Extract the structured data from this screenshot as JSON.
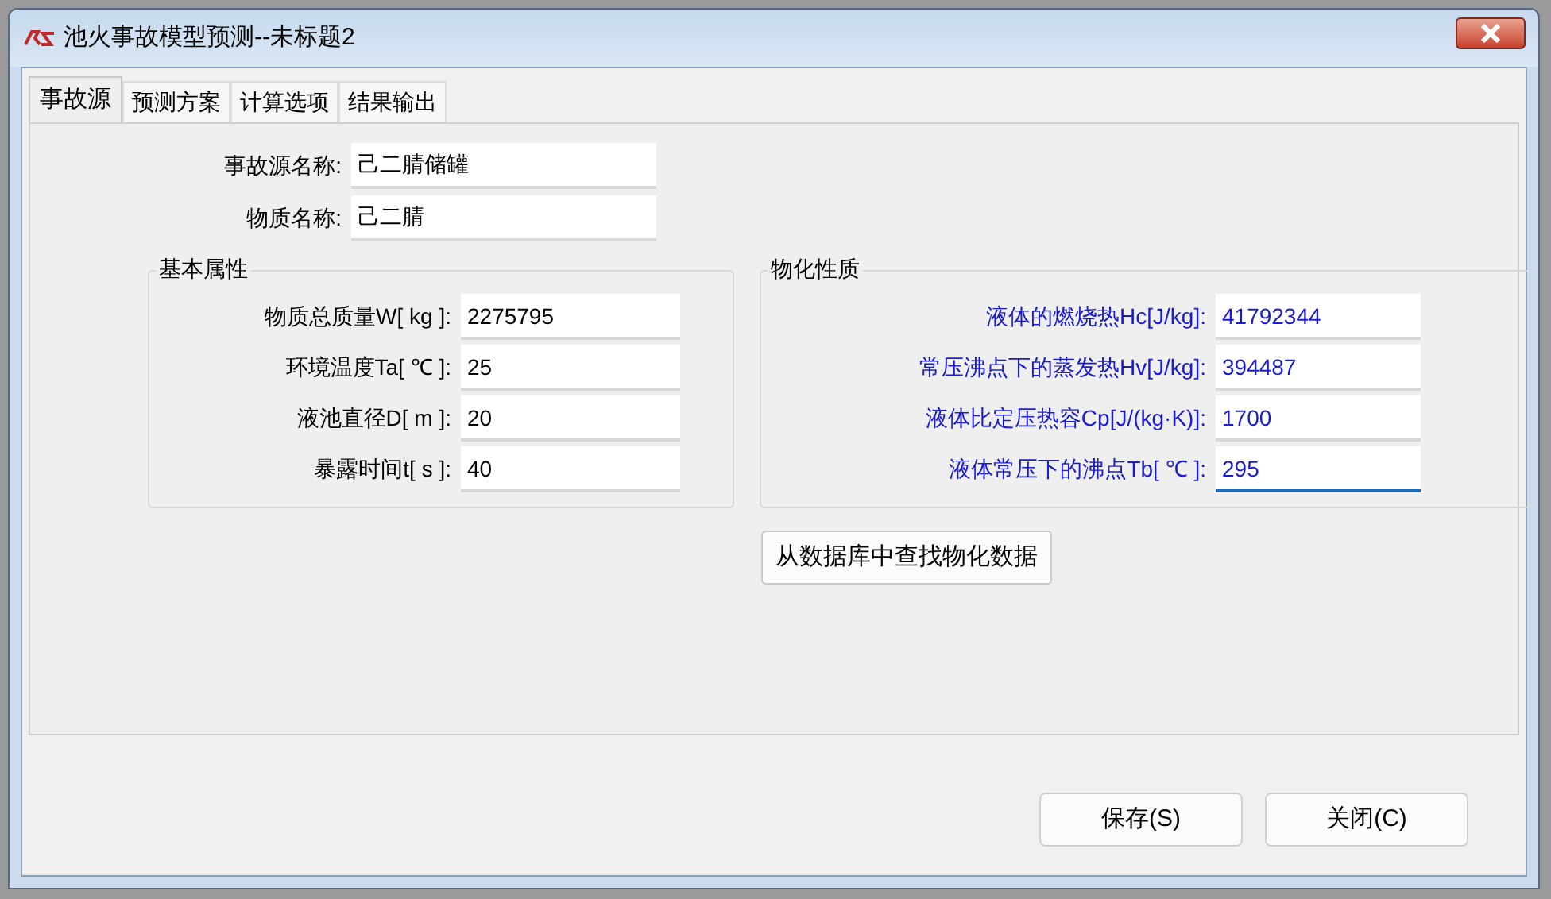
{
  "window": {
    "title": "池火事故模型预测--未标题2"
  },
  "tabs": [
    {
      "label": "事故源",
      "selected": true
    },
    {
      "label": "预测方案",
      "selected": false
    },
    {
      "label": "计算选项",
      "selected": false
    },
    {
      "label": "结果输出",
      "selected": false
    }
  ],
  "source_fields": [
    {
      "label": "事故源名称:",
      "value": "己二腈储罐"
    },
    {
      "label": "物质名称:",
      "value": "己二腈"
    }
  ],
  "basic_properties": {
    "title": "基本属性",
    "fields": [
      {
        "label": "物质总质量W[ kg ]:",
        "value": "2275795",
        "focused": false
      },
      {
        "label": "环境温度Ta[ ℃ ]:",
        "value": "25",
        "focused": false
      },
      {
        "label": "液池直径D[  m ]:",
        "value": "20",
        "focused": false
      },
      {
        "label": "暴露时间t[ s ]:",
        "value": "40",
        "focused": false
      }
    ]
  },
  "physchem_properties": {
    "title": "物化性质",
    "fields": [
      {
        "label": "液体的燃烧热Hc[J/kg]:",
        "value": "41792344",
        "focused": false
      },
      {
        "label": "常压沸点下的蒸发热Hv[J/kg]:",
        "value": "394487",
        "focused": false
      },
      {
        "label": "液体比定压热容Cp[J/(kg·K)]:",
        "value": "1700",
        "focused": false
      },
      {
        "label": "液体常压下的沸点Tb[ ℃ ]:",
        "value": "295",
        "focused": true
      }
    ]
  },
  "lookup_button": "从数据库中查找物化数据",
  "buttons": [
    "保存(S)",
    "关闭(C)"
  ]
}
